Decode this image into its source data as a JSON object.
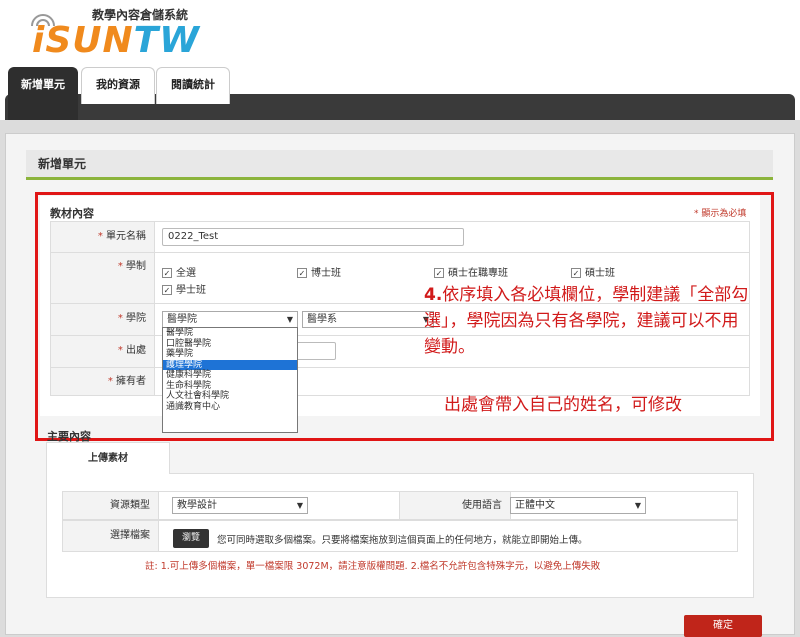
{
  "brand": {
    "subtitle": "教學內容倉儲系統",
    "word_part1": "iSUN",
    "word_part2": "TW",
    "accent_orange": "#f08a1d",
    "accent_blue": "#2aa5d8"
  },
  "tabs": [
    {
      "label": "新增單元",
      "active": true
    },
    {
      "label": "我的資源",
      "active": false
    },
    {
      "label": "閱讀統計",
      "active": false
    }
  ],
  "section_title": "新增單元",
  "form": {
    "title": "教材內容",
    "required_note": "* 顯示為必填",
    "unit_name": {
      "label": "單元名稱",
      "value": "0222_Test"
    },
    "degree": {
      "label": "學制",
      "options": [
        {
          "label": "全選",
          "checked": true
        },
        {
          "label": "博士班",
          "checked": true
        },
        {
          "label": "碩士在職專班",
          "checked": true
        },
        {
          "label": "碩士班",
          "checked": true
        },
        {
          "label": "學士班",
          "checked": true
        }
      ]
    },
    "college": {
      "label": "學院",
      "selected": "醫學院",
      "dept_selected": "醫學系"
    },
    "source": {
      "label": "出處"
    },
    "owner": {
      "label": "擁有者"
    },
    "dropdown_options": [
      "醫學院",
      "口腔醫學院",
      "藥學院",
      "護理學院",
      "健康科學院",
      "生命科學院",
      "人文社會科學院",
      "通識教育中心"
    ],
    "dropdown_highlighted": "護理學院"
  },
  "annotation": {
    "num": "4.",
    "text": "依序填入各必填欄位，學制建議「全部勾選」，學院因為只有各學院，建議可以不用變動。",
    "text2": "出處會帶入自己的姓名，可修改",
    "color": "#d11a1a"
  },
  "main": {
    "title": "主要內容",
    "upload_tab": "上傳素材",
    "resource_type": {
      "label": "資源類型",
      "value": "教學設計"
    },
    "language": {
      "label": "使用語言",
      "value": "正體中文"
    },
    "file_select": {
      "label": "選擇檔案",
      "browse": "瀏覽",
      "hint": "您可同時選取多個檔案。只要將檔案拖放到這個頁面上的任何地方，就能立即開始上傳。"
    },
    "note": "註: 1.可上傳多個檔案，單一檔案限 3072M，請注意版權問題. 2.檔名不允許包含特殊字元，以避免上傳失敗"
  },
  "confirm_button": "確定"
}
